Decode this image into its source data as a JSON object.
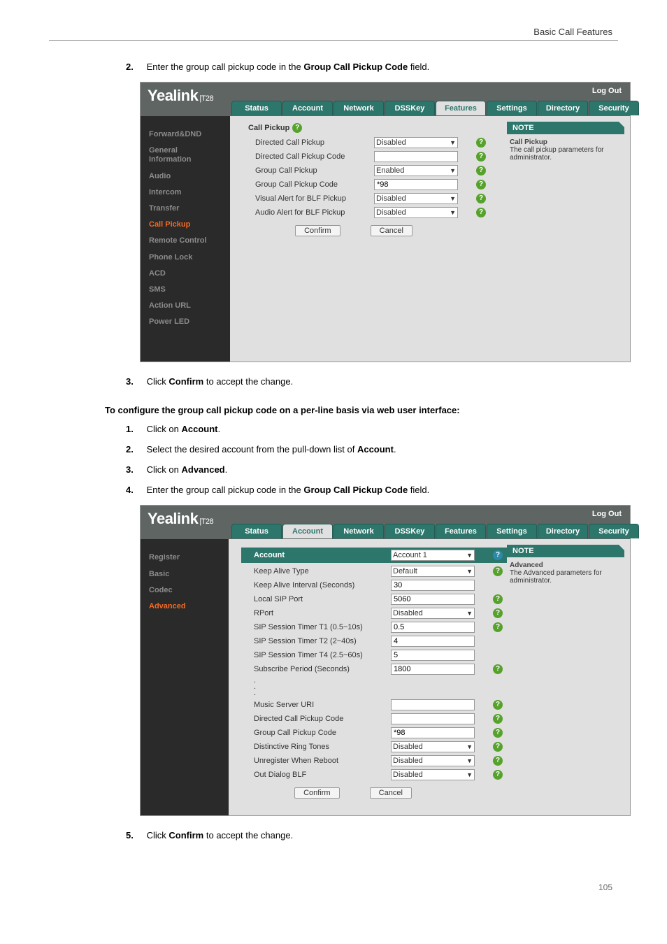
{
  "doc": {
    "header_right": "Basic Call Features",
    "page_number": "105",
    "steps_top": {
      "num": "2.",
      "text_before": "Enter the group call pickup code in the ",
      "bold": "Group Call Pickup Code",
      "text_after": " field."
    },
    "step3": {
      "num": "3.",
      "text_before": "Click ",
      "bold": "Confirm",
      "text_after": " to accept the change."
    },
    "config_heading": "To configure the group call pickup code on a per-line basis via web user interface:",
    "step_a1": {
      "num": "1.",
      "text_before": "Click on ",
      "bold": "Account",
      "text_after": "."
    },
    "step_a2": {
      "num": "2.",
      "text_before": "Select the desired account from the pull-down list of ",
      "bold": "Account",
      "text_after": "."
    },
    "step_a3": {
      "num": "3.",
      "text_before": "Click on ",
      "bold": "Advanced",
      "text_after": "."
    },
    "step_a4": {
      "num": "4.",
      "text_before": "Enter the group call pickup code in the ",
      "bold": "Group Call Pickup Code",
      "text_after": " field."
    },
    "step5": {
      "num": "5.",
      "text_before": "Click ",
      "bold": "Confirm",
      "text_after": " to accept the change."
    }
  },
  "shot1": {
    "brand": "Yealink",
    "brand_suffix": "T28",
    "logout": "Log Out",
    "tabs": [
      "Status",
      "Account",
      "Network",
      "DSSKey",
      "Features",
      "Settings",
      "Directory",
      "Security"
    ],
    "tab_active": "Features",
    "sidebar_items": [
      "Forward&DND",
      "General Information",
      "Audio",
      "Intercom",
      "Transfer",
      "Call Pickup",
      "Remote Control",
      "Phone Lock",
      "ACD",
      "SMS",
      "Action URL",
      "Power LED"
    ],
    "sidebar_active": "Call Pickup",
    "section_title": "Call Pickup",
    "rows": [
      {
        "label": "Directed Call Pickup",
        "type": "select",
        "value": "Disabled",
        "q": true
      },
      {
        "label": "Directed Call Pickup Code",
        "type": "text",
        "value": "",
        "q": true
      },
      {
        "label": "Group Call Pickup",
        "type": "select",
        "value": "Enabled",
        "q": true
      },
      {
        "label": "Group Call Pickup Code",
        "type": "text",
        "value": "*98",
        "q": true
      },
      {
        "label": "Visual Alert for BLF Pickup",
        "type": "select",
        "value": "Disabled",
        "q": true
      },
      {
        "label": "Audio Alert for BLF Pickup",
        "type": "select",
        "value": "Disabled",
        "q": true
      }
    ],
    "buttons": {
      "confirm": "Confirm",
      "cancel": "Cancel"
    },
    "note_title": "NOTE",
    "note_head": "Call Pickup",
    "note_body": "The call pickup parameters for administrator."
  },
  "shot2": {
    "brand": "Yealink",
    "brand_suffix": "T28",
    "logout": "Log Out",
    "tabs": [
      "Status",
      "Account",
      "Network",
      "DSSKey",
      "Features",
      "Settings",
      "Directory",
      "Security"
    ],
    "tab_active": "Account",
    "sidebar_items": [
      "Register",
      "Basic",
      "Codec",
      "Advanced"
    ],
    "sidebar_active": "Advanced",
    "rows_top": [
      {
        "label": "Account",
        "type": "select",
        "value": "Account 1",
        "q": true,
        "highlight": true
      },
      {
        "label": "Keep Alive Type",
        "type": "select",
        "value": "Default",
        "q": true
      },
      {
        "label": "Keep Alive Interval (Seconds)",
        "type": "text",
        "value": "30"
      },
      {
        "label": "Local SIP Port",
        "type": "text",
        "value": "5060",
        "q": true
      },
      {
        "label": "RPort",
        "type": "select",
        "value": "Disabled",
        "q": true
      },
      {
        "label": "SIP Session Timer T1 (0.5~10s)",
        "type": "text",
        "value": "0.5",
        "q": true
      },
      {
        "label": "SIP Session Timer T2 (2~40s)",
        "type": "text",
        "value": "4"
      },
      {
        "label": "SIP Session Timer T4 (2.5~60s)",
        "type": "text",
        "value": "5"
      },
      {
        "label": "Subscribe Period (Seconds)",
        "type": "text",
        "value": "1800",
        "q": true
      }
    ],
    "rows_bottom": [
      {
        "label": "Music Server URI",
        "type": "text",
        "value": "",
        "q": true
      },
      {
        "label": "Directed Call Pickup Code",
        "type": "text",
        "value": "",
        "q": true
      },
      {
        "label": "Group Call Pickup Code",
        "type": "text",
        "value": "*98",
        "q": true
      },
      {
        "label": "Distinctive Ring Tones",
        "type": "select",
        "value": "Disabled",
        "q": true
      },
      {
        "label": "Unregister When Reboot",
        "type": "select",
        "value": "Disabled",
        "q": true
      },
      {
        "label": "Out Dialog BLF",
        "type": "select",
        "value": "Disabled",
        "q": true
      }
    ],
    "buttons": {
      "confirm": "Confirm",
      "cancel": "Cancel"
    },
    "note_title": "NOTE",
    "note_head": "Advanced",
    "note_body": "The Advanced parameters for administrator."
  }
}
